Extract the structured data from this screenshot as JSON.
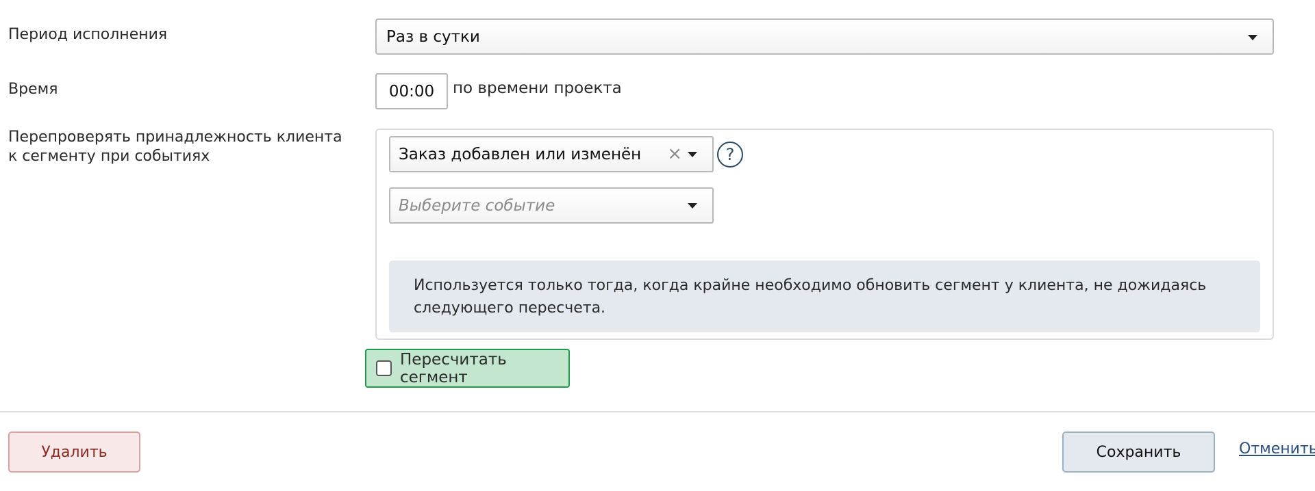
{
  "form": {
    "period": {
      "label": "Период исполнения",
      "value": "Раз в сутки"
    },
    "time": {
      "label": "Время",
      "value": "00:00",
      "suffix": "по времени проекта"
    },
    "recheck": {
      "label": "Перепроверять принадлежность клиента к сегменту при событиях",
      "selected_event": "Заказ добавлен или изменён",
      "event_placeholder": "Выберите событие",
      "help": "?",
      "info": "Используется только тогда, когда крайне необходимо обновить сегмент у клиента, не дожидаясь следующего пересчета."
    },
    "recalc": {
      "label": "Пересчитать сегмент",
      "checked": false
    }
  },
  "footer": {
    "delete_label": "Удалить",
    "save_label": "Сохранить",
    "cancel_label": "Отменить"
  },
  "colors": {
    "recalc_bg": "#c3e6cf",
    "recalc_border": "#1f9a4a",
    "delete_text": "#8a2a22",
    "info_bg": "#e4e8ef",
    "link": "#2a4f80"
  }
}
